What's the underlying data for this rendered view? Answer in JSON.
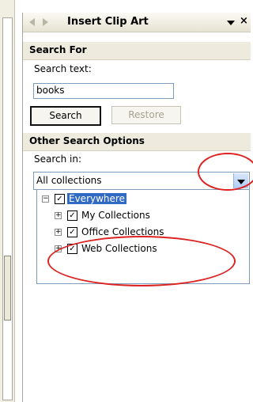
{
  "pane": {
    "title": "Insert Clip Art",
    "close_glyph": "×"
  },
  "search_for": {
    "heading": "Search For",
    "label": "Search text:",
    "value": "books",
    "search_button": "Search",
    "restore_button": "Restore"
  },
  "other_options": {
    "heading": "Other Search Options",
    "label": "Search in:",
    "selected": "All collections"
  },
  "tree": {
    "root": "Everywhere",
    "children": [
      "My Collections",
      "Office Collections",
      "Web Collections"
    ]
  },
  "icons": {
    "back": "left-arrow-icon",
    "forward": "right-arrow-icon",
    "menu": "dropdown-triangle-icon",
    "close": "close-icon"
  },
  "colors": {
    "selection": "#316ac5",
    "annotation": "#dd2222",
    "pane_header": "#eeebde"
  }
}
